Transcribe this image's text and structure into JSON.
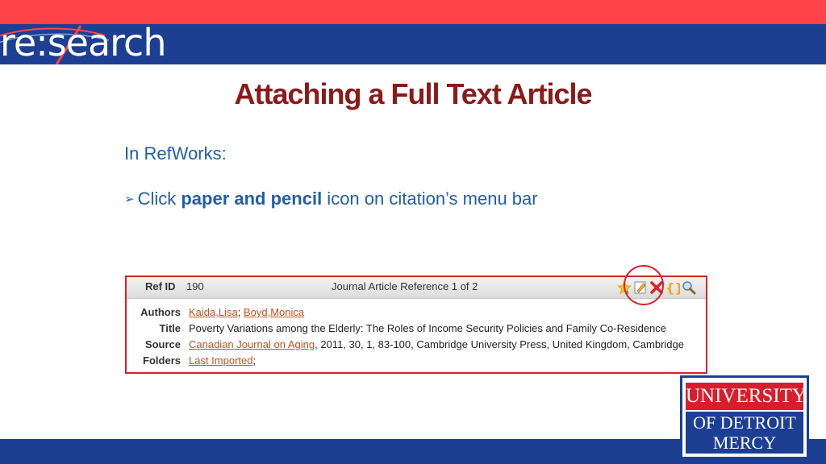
{
  "header": {
    "logo_text": "re:search"
  },
  "slide": {
    "title": "Attaching a Full Text Article",
    "intro": "In RefWorks:",
    "bullet_pre": "Click ",
    "bullet_bold": "paper and pencil",
    "bullet_post": " icon on citation’s menu bar"
  },
  "reference": {
    "ref_id_label": "Ref ID",
    "ref_id": "190",
    "ref_type": "Journal Article Reference 1 of 2",
    "icons": [
      "star-icon",
      "pencil-paper-icon",
      "delete-x-icon",
      "braces-icon",
      "magnifier-icon"
    ],
    "rows": {
      "authors_label": "Authors",
      "author_1": "Kaida,Lisa",
      "author_sep": "; ",
      "author_2": "Boyd,Monica",
      "title_label": "Title",
      "title": "Poverty Variations among the Elderly: The Roles of Income Security Policies and Family Co-Residence",
      "source_label": "Source",
      "source_link": "Canadian Journal on Aging",
      "source_rest": ", 2011, 30, 1, 83-100, Cambridge University Press, United Kingdom, Cambridge",
      "folders_label": "Folders",
      "folder": "Last Imported",
      "folder_suffix": ";"
    }
  },
  "university_logo": {
    "line1": "UNIVERSITY",
    "line2": "OF DETROIT",
    "line3": "MERCY"
  },
  "colors": {
    "top_red": "#ff4348",
    "brand_blue": "#1c3f94",
    "title_red": "#8b1a1a",
    "text_blue": "#1f5fa8",
    "link_orange": "#c8501a"
  }
}
